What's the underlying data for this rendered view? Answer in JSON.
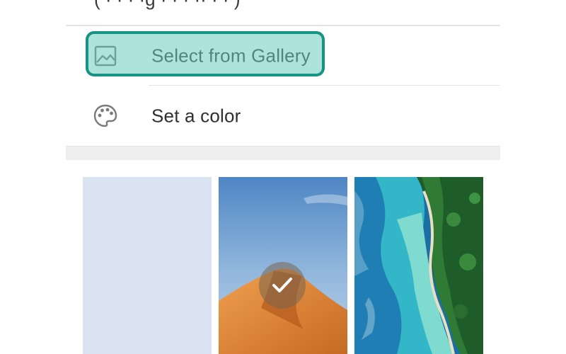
{
  "top_row": {
    "partial_text": "( ·      · ·  ·g  ·  · ·  ·· ·  ·  )"
  },
  "menu": {
    "items": [
      {
        "label": "Select from Gallery",
        "icon": "image-icon"
      },
      {
        "label": "Set a color",
        "icon": "palette-icon"
      }
    ]
  },
  "wallpapers": [
    {
      "kind": "solid-color",
      "color": "#d9e3f2",
      "selected": false
    },
    {
      "kind": "image",
      "subject": "desert dune under blue sky",
      "selected": true
    },
    {
      "kind": "image",
      "subject": "aerial tropical coastline",
      "selected": false
    }
  ],
  "colors": {
    "highlight_border": "#169486",
    "highlight_fill": "#68cdbe",
    "icon": "#8a8a8a"
  }
}
